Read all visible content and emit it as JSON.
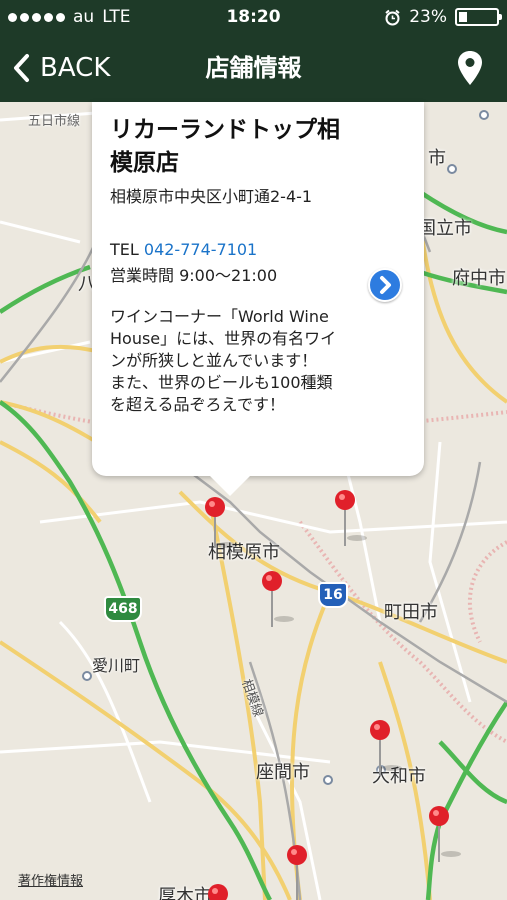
{
  "status": {
    "carrier": "au",
    "network": "LTE",
    "time": "18:20",
    "battery": "23%",
    "battery_level": 0.23
  },
  "nav": {
    "back_label": "BACK",
    "title": "店舗情報",
    "pin_icon": "map-pin-icon"
  },
  "store": {
    "name": "リカーランドトップ相模原店",
    "address": "相模原市中央区小町通2-4-1",
    "tel_label": "TEL",
    "tel": "042-774-7101",
    "hours": "営業時間 9:00〜21:00",
    "description": "ワインコーナー「World Wine House」には、世界の有名ワインが所狭しと並んでいます！\nまた、世界のビールも100種類を超える品ぞろえです！"
  },
  "map": {
    "credit": "著作権情報",
    "places": [
      {
        "name": "五日市線",
        "key": "itsukaichi-line"
      },
      {
        "name": "市",
        "key": "city-top"
      },
      {
        "name": "国立市",
        "key": "kunitachi"
      },
      {
        "name": "府中市",
        "key": "fuchu"
      },
      {
        "name": "八",
        "key": "hachi"
      },
      {
        "name": "相模原市",
        "key": "sagamihara"
      },
      {
        "name": "町田市",
        "key": "machida"
      },
      {
        "name": "愛川町",
        "key": "aikawa"
      },
      {
        "name": "座間市",
        "key": "zama"
      },
      {
        "name": "大和市",
        "key": "yamato"
      },
      {
        "name": "厚木市",
        "key": "atsugi"
      },
      {
        "name": "相模線",
        "key": "sagami-line"
      }
    ],
    "route_badges": [
      {
        "number": "468",
        "key": "468"
      },
      {
        "number": "16",
        "key": "16"
      }
    ],
    "colors": {
      "highway": "#4fb853",
      "national_road": "#f2d070",
      "road": "#ffffff",
      "boundary": "#e8a8a8",
      "pin": "#e0202a"
    }
  }
}
